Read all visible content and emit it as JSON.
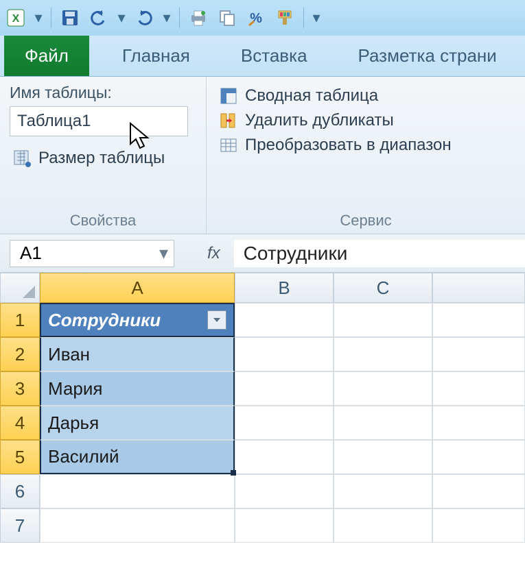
{
  "qat": {
    "icons": [
      "excel-logo-icon",
      "save-icon",
      "undo-icon",
      "redo-icon",
      "print-icon",
      "copy-icon",
      "percent-style-icon",
      "format-painter-icon"
    ]
  },
  "tabs": {
    "file": "Файл",
    "home": "Главная",
    "insert": "Вставка",
    "page_layout": "Разметка страни"
  },
  "ribbon": {
    "group_props": {
      "table_name_label": "Имя таблицы:",
      "table_name_value": "Таблица1",
      "resize_label": "Размер таблицы",
      "title": "Свойства"
    },
    "group_tools": {
      "pivot": "Сводная таблица",
      "remove_dupes": "Удалить дубликаты",
      "convert_range": "Преобразовать в диапазон",
      "title": "Сервис"
    }
  },
  "namebox": {
    "value": "A1"
  },
  "formula_fx": "fx",
  "formula_value": "Сотрудники",
  "columns": [
    "A",
    "B",
    "C"
  ],
  "rows": [
    "1",
    "2",
    "3",
    "4",
    "5",
    "6",
    "7"
  ],
  "table": {
    "header": "Сотрудники",
    "rows": [
      "Иван",
      "Мария",
      "Дарья",
      "Василий"
    ]
  }
}
